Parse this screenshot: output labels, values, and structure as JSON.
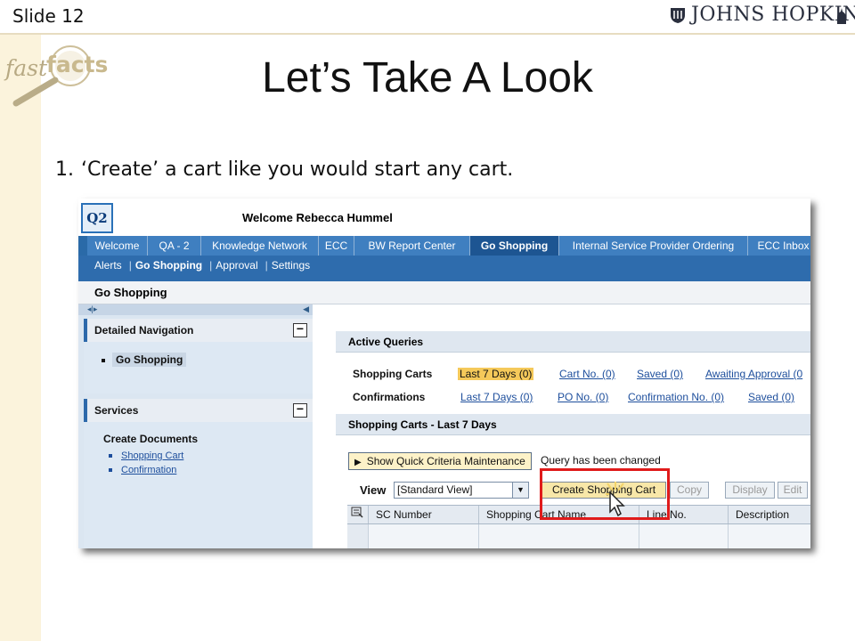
{
  "slide": {
    "number_label": "Slide 12",
    "logo_text": "JOHNS HOPKINS",
    "fastfacts": {
      "fast": "fast",
      "facts": "facts"
    },
    "title": "Let’s Take A Look",
    "bullet": {
      "num": "1.",
      "text": "‘Create’ a cart like you would start any cart."
    }
  },
  "app": {
    "logo": "Q2",
    "welcome": "Welcome Rebecca Hummel",
    "tabs": [
      "Welcome",
      "QA - 2",
      "Knowledge Network",
      "ECC",
      "BW Report Center",
      "Go Shopping",
      "Internal Service Provider Ordering",
      "ECC Inbox"
    ],
    "active_tab": "Go Shopping",
    "subnav": [
      "Alerts",
      "Go Shopping",
      "Approval",
      "Settings"
    ],
    "subnav_sep": "|",
    "page_title": "Go Shopping",
    "left_nav": {
      "detailed_nav_title": "Detailed Navigation",
      "detailed_item": "Go Shopping",
      "services_title": "Services",
      "create_documents": "Create Documents",
      "links": [
        "Shopping Cart",
        "Confirmation"
      ],
      "collapse_symbol": "−"
    },
    "active_queries": {
      "title": "Active Queries",
      "shopping_carts_label": "Shopping Carts",
      "shopping_carts_links": [
        "Last 7 Days (0)",
        "Cart No. (0)",
        "Saved (0)",
        "Awaiting Approval (0"
      ],
      "confirmations_label": "Confirmations",
      "confirmations_links": [
        "Last 7 Days (0)",
        "PO No. (0)",
        "Confirmation No. (0)",
        "Saved (0)"
      ]
    },
    "results": {
      "title": "Shopping Carts - Last 7 Days",
      "show_criteria": "Show Quick Criteria Maintenance",
      "query_changed": "Query has been changed",
      "view_label": "View",
      "view_value": "[Standard View]",
      "buttons": {
        "create": "Create Shopping Cart",
        "copy": "Copy",
        "display": "Display",
        "edit": "Edit"
      },
      "columns": [
        "SC Number",
        "Shopping Cart Name",
        "Line No.",
        "Description"
      ]
    }
  },
  "colors": {
    "highlight_box": "#e01b1b",
    "tab_bar": "#2a6aa8",
    "slide_band": "#fbf3dc"
  }
}
